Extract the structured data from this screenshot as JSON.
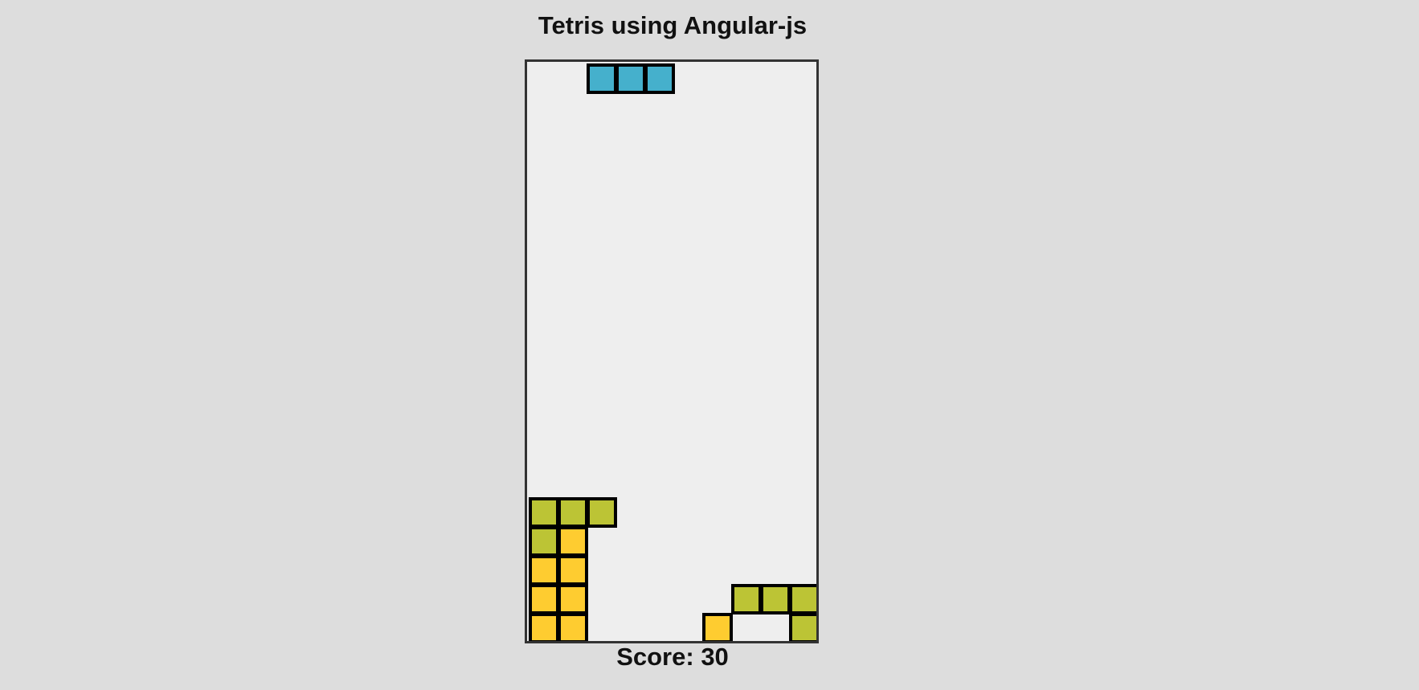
{
  "title": "Tetris using Angular-js",
  "score": {
    "label": "Score:",
    "value": 30
  },
  "board": {
    "columns": 10,
    "rows": 20,
    "colors": {
      "cyan": "#45b0cc",
      "olive": "#bcc435",
      "yellow": "#fecc30"
    },
    "active_piece": {
      "color": "cyan",
      "cells": [
        [
          0,
          2
        ],
        [
          0,
          3
        ],
        [
          0,
          4
        ]
      ]
    },
    "settled_cells": [
      {
        "row": 15,
        "col": 0,
        "color": "olive"
      },
      {
        "row": 15,
        "col": 1,
        "color": "olive"
      },
      {
        "row": 15,
        "col": 2,
        "color": "olive"
      },
      {
        "row": 16,
        "col": 0,
        "color": "olive"
      },
      {
        "row": 16,
        "col": 1,
        "color": "yellow"
      },
      {
        "row": 17,
        "col": 0,
        "color": "yellow"
      },
      {
        "row": 17,
        "col": 1,
        "color": "yellow"
      },
      {
        "row": 18,
        "col": 0,
        "color": "yellow"
      },
      {
        "row": 18,
        "col": 1,
        "color": "yellow"
      },
      {
        "row": 18,
        "col": 7,
        "color": "olive"
      },
      {
        "row": 18,
        "col": 8,
        "color": "olive"
      },
      {
        "row": 18,
        "col": 9,
        "color": "olive"
      },
      {
        "row": 19,
        "col": 0,
        "color": "yellow"
      },
      {
        "row": 19,
        "col": 1,
        "color": "yellow"
      },
      {
        "row": 19,
        "col": 6,
        "color": "yellow"
      },
      {
        "row": 19,
        "col": 9,
        "color": "olive"
      }
    ]
  }
}
